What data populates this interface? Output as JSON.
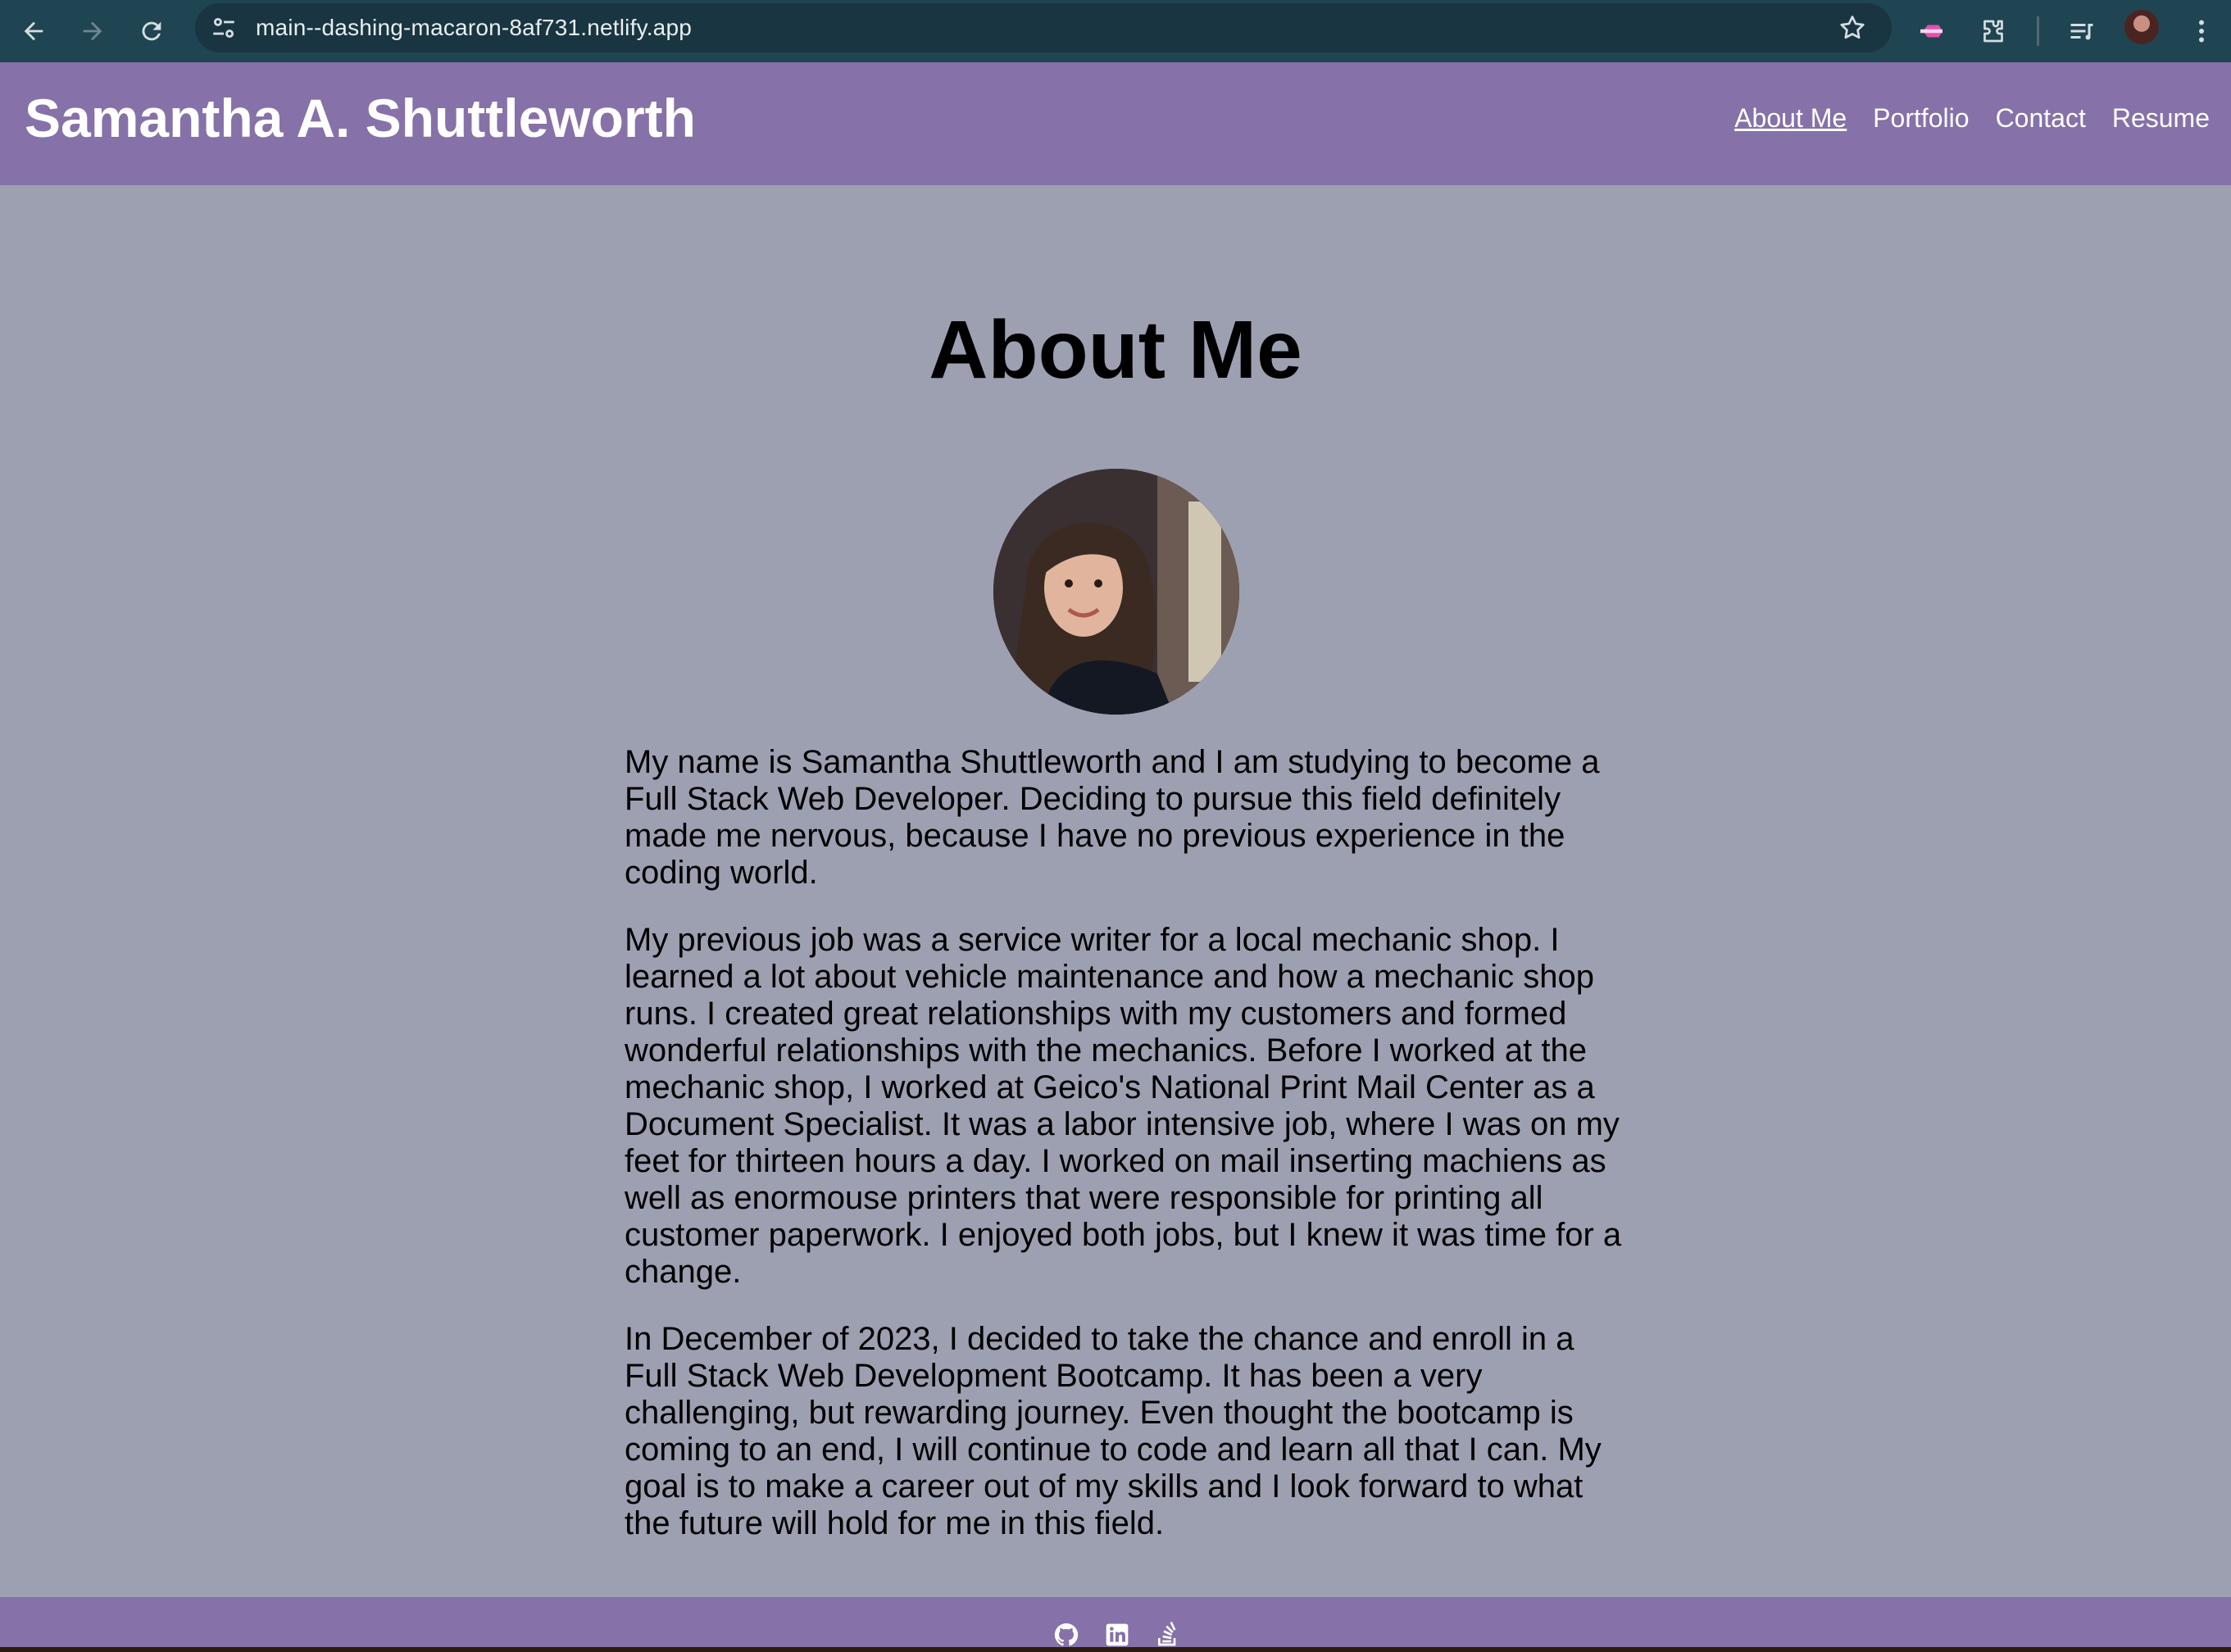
{
  "browser": {
    "url": "main--dashing-macaron-8af731.netlify.app",
    "icons": {
      "back": "arrow-left-icon",
      "forward": "arrow-right-icon",
      "reload": "reload-icon",
      "site_info": "tune-icon",
      "bookmark": "star-icon",
      "extension": "extension-icon",
      "puzzle": "puzzle-icon",
      "media": "playlist-icon",
      "menu": "kebab-menu-icon"
    },
    "colors": {
      "frame": "#1f4452",
      "omnibox": "#193541"
    }
  },
  "site": {
    "title": "Samantha A. Shuttleworth",
    "nav": [
      {
        "label": "About Me",
        "active": true
      },
      {
        "label": "Portfolio",
        "active": false
      },
      {
        "label": "Contact",
        "active": false
      },
      {
        "label": "Resume",
        "active": false
      }
    ],
    "colors": {
      "header": "#8671a8",
      "background": "#9da0b1",
      "text": "#000000"
    }
  },
  "main": {
    "heading": "About Me",
    "paragraphs": [
      "My name is Samantha Shuttleworth and I am studying to become a Full Stack Web Developer. Deciding to pursue this field definitely made me nervous, because I have no previous experience in the coding world.",
      "My previous job was a service writer for a local mechanic shop. I learned a lot about vehicle maintenance and how a mechanic shop runs. I created great relationships with my customers and formed wonderful relationships with the mechanics. Before I worked at the mechanic shop, I worked at Geico's National Print Mail Center as a Document Specialist. It was a labor intensive job, where I was on my feet for thirteen hours a day. I worked on mail inserting machiens as well as enormouse printers that were responsible for printing all customer paperwork. I enjoyed both jobs, but I knew it was time for a change.",
      "In December of 2023, I decided to take the chance and enroll in a Full Stack Web Development Bootcamp. It has been a very challenging, but rewarding journey. Even thought the bootcamp is coming to an end, I will continue to code and learn all that I can. My goal is to make a career out of my skills and I look forward to what the future will hold for me in this field."
    ]
  },
  "footer": {
    "icons": [
      "github-icon",
      "linkedin-icon",
      "stackoverflow-icon"
    ]
  }
}
